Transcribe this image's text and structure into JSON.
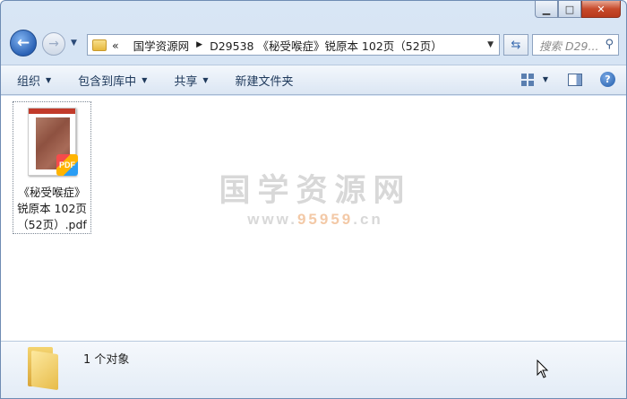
{
  "window": {
    "caption": {
      "minimize": "▁",
      "maximize": "□",
      "close": "✕"
    }
  },
  "address": {
    "overflow": "«",
    "crumbs": [
      "国学资源网",
      "D29538 《秘受喉症》锐原本 102页（52页）"
    ],
    "refresh_icon": "refresh-icon",
    "search_placeholder": "搜索 D29..."
  },
  "toolbar": {
    "organize": "组织",
    "include_in_library": "包含到库中",
    "share": "共享",
    "new_folder": "新建文件夹"
  },
  "file": {
    "name_line1": "《秘受喉症》",
    "name_line2": "锐原本 102页",
    "name_line3": "（52页）.pdf",
    "badge": "PDF"
  },
  "watermark": {
    "title": "国学资源网",
    "url_prefix": "www.",
    "url_highlight": "95959",
    "url_suffix": ".cn"
  },
  "details": {
    "count": "1 个对象"
  }
}
